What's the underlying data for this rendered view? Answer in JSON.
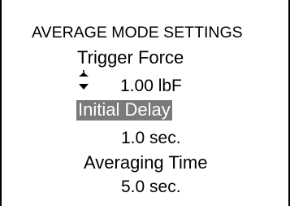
{
  "screen": {
    "title": "AVERAGE MODE SETTINGS",
    "items": [
      {
        "label": "Trigger Force",
        "value": "1.00  lbF",
        "selected": false,
        "has_adjust_arrows": true
      },
      {
        "label": "Initial Delay",
        "value": "1.0 sec.",
        "selected": true
      },
      {
        "label": "Averaging Time",
        "value": "5.0 sec.",
        "selected": false
      }
    ]
  },
  "icons": {
    "increase": "up-arrow-icon",
    "decrease": "down-arrow-icon"
  },
  "colors": {
    "background": "#ffffff",
    "text": "#000000",
    "highlight_background": "#7a7a7a",
    "highlight_text": "#ffffff"
  }
}
